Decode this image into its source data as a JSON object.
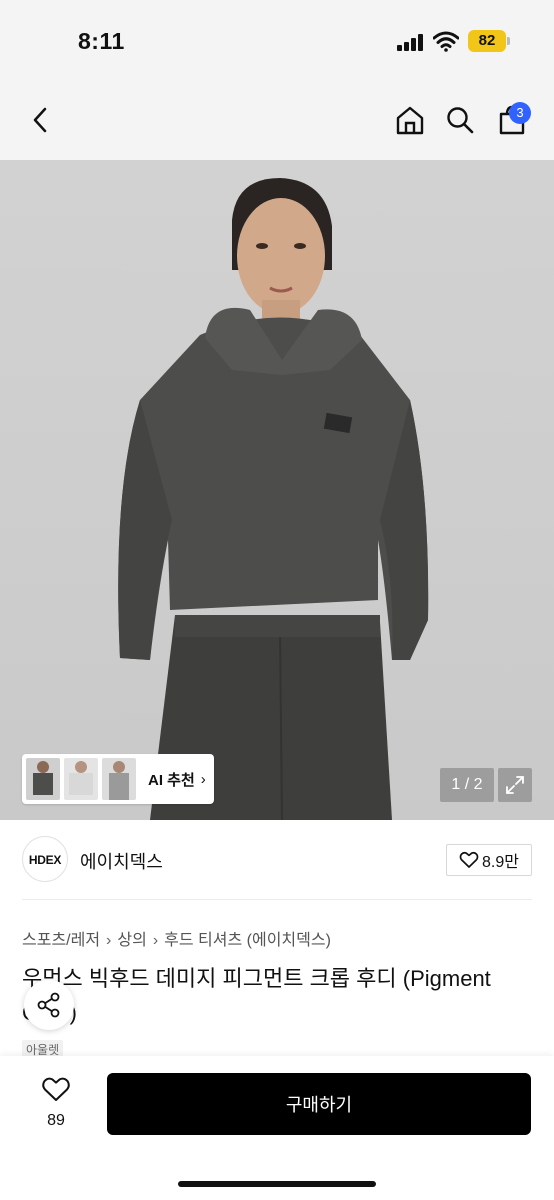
{
  "status_bar": {
    "time": "8:11",
    "battery": "82",
    "icons": [
      "signal-icon",
      "wifi-icon",
      "battery-icon"
    ]
  },
  "nav": {
    "icons": [
      "back-chevron-icon",
      "home-icon",
      "search-icon",
      "cart-icon"
    ],
    "cart_badge": "3"
  },
  "gallery": {
    "ai_label": "AI 추천",
    "page_indicator": "1 / 2",
    "thumbnail_count": 3
  },
  "brand": {
    "logo_text": "HDEX",
    "name": "에이치덱스",
    "likes": "8.9만"
  },
  "breadcrumb": [
    "스포츠/레저",
    "상의",
    "후드 티셔츠 (에이치덱스)"
  ],
  "product": {
    "title": "우먼스 빅후드 데미지 피그먼트 크롭 후디 (Pigment Gray)",
    "tag": "아울렛"
  },
  "bottom": {
    "like_count": "89",
    "buy_label": "구매하기"
  },
  "colors": {
    "accent_badge": "#2f62ff",
    "battery": "#f2c619",
    "buy_button": "#000000"
  }
}
